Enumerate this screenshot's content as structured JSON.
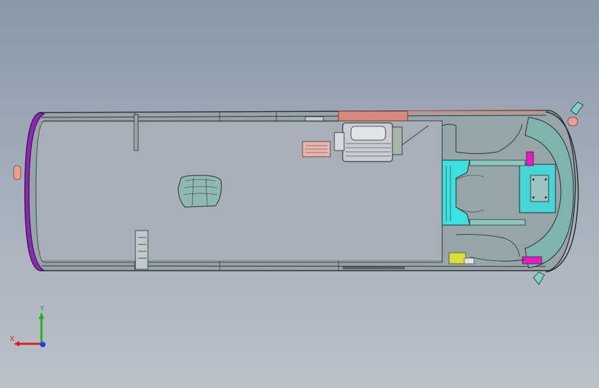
{
  "viewport": {
    "background_top": "#8b97a8",
    "background_bottom": "#bcc1c8"
  },
  "triad": {
    "x_label": "X",
    "y_label": "Y",
    "x_color": "#d42020",
    "y_color": "#20b020",
    "z_color": "#2040e0"
  },
  "model": {
    "body_color": "#8fa3a3",
    "floor_color": "#a7aeb7",
    "front_cap_color": "#8a2ab0",
    "rear_panel_color": "#7fb3ad",
    "accent_cyan": "#3fe0e0",
    "accent_magenta": "#e020c0",
    "roof_strip_color": "#d98a80"
  }
}
